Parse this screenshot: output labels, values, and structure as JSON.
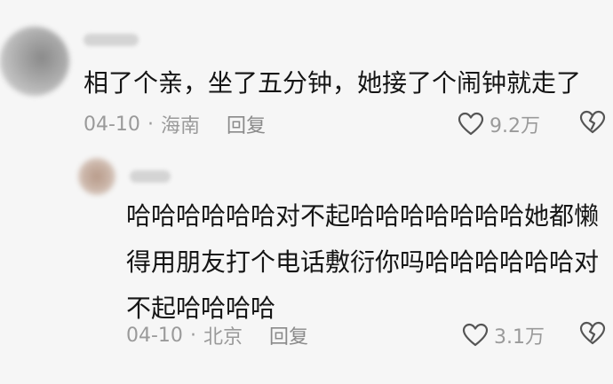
{
  "comments": [
    {
      "text": "相了个亲，坐了五分钟，她接了个闹钟就走了",
      "date": "04-10",
      "separator": "·",
      "location": "海南",
      "reply_label": "回复",
      "likes": "9.2万",
      "avatar_icon": "blurred-avatar",
      "like_icon": "heart-outline-icon",
      "dislike_icon": "broken-heart-icon"
    },
    {
      "text": "哈哈哈哈哈哈对不起哈哈哈哈哈哈哈她都懒得用朋友打个电话敷衍你吗哈哈哈哈哈哈对不起哈哈哈哈",
      "date": "04-10",
      "separator": "·",
      "location": "北京",
      "reply_label": "回复",
      "likes": "3.1万",
      "avatar_icon": "blurred-avatar",
      "like_icon": "heart-outline-icon",
      "dislike_icon": "broken-heart-icon"
    }
  ],
  "colors": {
    "background": "#f6f6f6",
    "text": "#151515",
    "meta": "#9a9a9a"
  }
}
